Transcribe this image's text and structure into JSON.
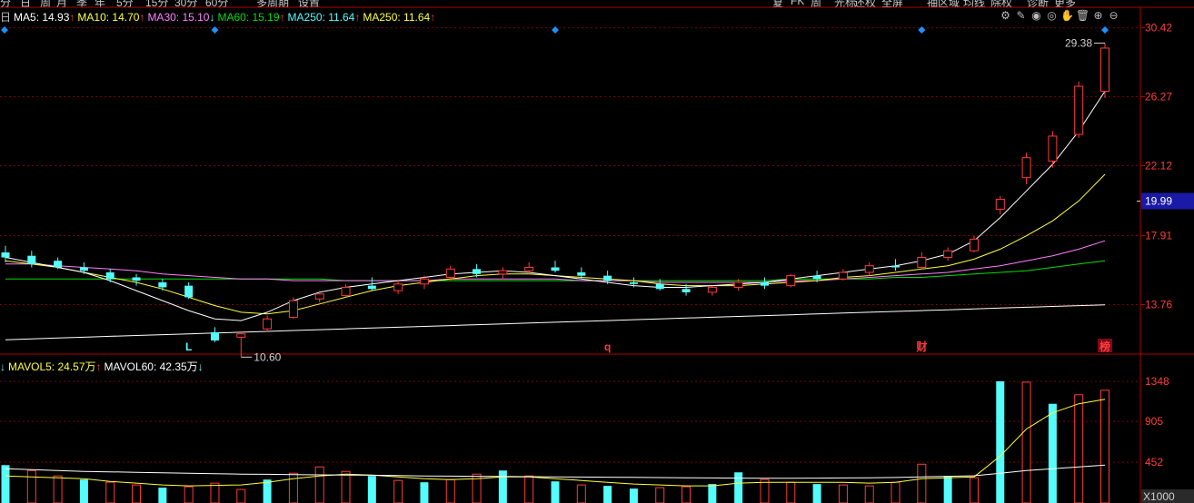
{
  "colors": {
    "up": "#ff3b3b",
    "down": "#54fcfc",
    "ma5": "#ffffff",
    "ma10": "#ffff3c",
    "ma30": "#ff80ff",
    "ma60": "#00e000",
    "ma250": "#ffffff",
    "grid": "#7a0000",
    "axis_text": "#ff3b3b",
    "diamond": "#1e90ff"
  },
  "toolbar": {
    "items": [
      "分",
      "日",
      "周",
      "月",
      "季",
      "年",
      "5分",
      "15分",
      "30分",
      "60分",
      "多周期",
      "设置",
      "复",
      "FK",
      "周",
      "光标",
      "还权",
      "全屏",
      "抽区域",
      "均线",
      "除权",
      "诊断",
      "更多"
    ]
  },
  "legend": {
    "prefix": "日",
    "items": [
      {
        "label": "MA5: 14.93",
        "arrow": "↑",
        "color": "#ffffff"
      },
      {
        "label": "MA10: 14.70",
        "arrow": "↑",
        "color": "#ffff3c"
      },
      {
        "label": "MA30: 15.10",
        "arrow": "↓",
        "color": "#ff80ff"
      },
      {
        "label": "MA60: 15.19",
        "arrow": "↑",
        "color": "#00e000"
      },
      {
        "label": "MA250: 11.64",
        "arrow": "↑",
        "color": "#54fcfc"
      },
      {
        "label": "MA250: 11.64",
        "arrow": "↑",
        "color": "#ffff3c"
      }
    ]
  },
  "vol_legend": {
    "items": [
      {
        "label": "↓",
        "arrow": "",
        "color": "#54fcfc"
      },
      {
        "label": "MAVOL5: 24.57万",
        "arrow": "↑",
        "color": "#ffff3c"
      },
      {
        "label": "MAVOL60: 42.35万",
        "arrow": "↓",
        "color": "#ffffff"
      }
    ]
  },
  "tools": {
    "icons": [
      "gear-icon",
      "pencil-icon",
      "eye-icon",
      "eye-closed-icon",
      "hand-icon",
      "trash-icon",
      "zoom-in-icon",
      "zoom-out-icon"
    ],
    "glyphs": [
      "⚙",
      "✎",
      "◉",
      "◎",
      "✋",
      "🗑",
      "⊕",
      "⊖"
    ]
  },
  "markers": {
    "high_label": "29.38",
    "low_label": "10.60",
    "current_price": "19.99",
    "letters": [
      {
        "text": "L",
        "color": "#54fcfc",
        "index": 7
      },
      {
        "text": "q",
        "color": "#ff3b3b",
        "index": 23
      },
      {
        "text": "财",
        "color": "#ff3b3b",
        "index": 35
      },
      {
        "text": "榜",
        "color": "#ff3b3b",
        "index": 42,
        "boxed": true
      }
    ],
    "diamond_indices": [
      0,
      8,
      21,
      35,
      42
    ]
  },
  "chart_data": [
    {
      "type": "candlestick",
      "title": "",
      "ylim": [
        11.0,
        31.0
      ],
      "yticks": [
        "30.42",
        "26.27",
        "22.12",
        "17.91",
        "13.76"
      ],
      "ytick_values": [
        30.42,
        26.27,
        22.12,
        17.91,
        13.76
      ],
      "candles": [
        {
          "o": 16.9,
          "h": 17.3,
          "l": 16.3,
          "c": 16.6
        },
        {
          "o": 16.7,
          "h": 17.0,
          "l": 16.0,
          "c": 16.2
        },
        {
          "o": 16.4,
          "h": 16.6,
          "l": 15.9,
          "c": 16.0
        },
        {
          "o": 16.0,
          "h": 16.3,
          "l": 15.6,
          "c": 15.8
        },
        {
          "o": 15.7,
          "h": 15.9,
          "l": 15.1,
          "c": 15.3
        },
        {
          "o": 15.4,
          "h": 15.6,
          "l": 14.9,
          "c": 15.2
        },
        {
          "o": 15.1,
          "h": 15.3,
          "l": 14.6,
          "c": 14.8
        },
        {
          "o": 14.9,
          "h": 15.1,
          "l": 14.1,
          "c": 14.2
        },
        {
          "o": 12.1,
          "h": 12.4,
          "l": 11.5,
          "c": 11.6
        },
        {
          "o": 11.8,
          "h": 12.1,
          "l": 10.6,
          "c": 12.0
        },
        {
          "o": 12.3,
          "h": 13.1,
          "l": 12.1,
          "c": 12.9
        },
        {
          "o": 13.0,
          "h": 14.2,
          "l": 12.9,
          "c": 14.0
        },
        {
          "o": 14.1,
          "h": 14.6,
          "l": 13.9,
          "c": 14.4
        },
        {
          "o": 14.3,
          "h": 15.0,
          "l": 14.2,
          "c": 14.8
        },
        {
          "o": 14.9,
          "h": 15.4,
          "l": 14.6,
          "c": 14.7
        },
        {
          "o": 14.6,
          "h": 15.2,
          "l": 14.4,
          "c": 15.0
        },
        {
          "o": 15.0,
          "h": 15.5,
          "l": 14.7,
          "c": 15.3
        },
        {
          "o": 15.4,
          "h": 16.1,
          "l": 15.2,
          "c": 15.9
        },
        {
          "o": 15.9,
          "h": 16.2,
          "l": 15.4,
          "c": 15.6
        },
        {
          "o": 15.6,
          "h": 16.0,
          "l": 15.3,
          "c": 15.8
        },
        {
          "o": 15.8,
          "h": 16.3,
          "l": 15.6,
          "c": 16.0
        },
        {
          "o": 16.0,
          "h": 16.4,
          "l": 15.7,
          "c": 15.8
        },
        {
          "o": 15.7,
          "h": 16.0,
          "l": 15.3,
          "c": 15.5
        },
        {
          "o": 15.5,
          "h": 15.8,
          "l": 15.0,
          "c": 15.2
        },
        {
          "o": 15.1,
          "h": 15.4,
          "l": 14.8,
          "c": 15.0
        },
        {
          "o": 15.0,
          "h": 15.3,
          "l": 14.6,
          "c": 14.7
        },
        {
          "o": 14.7,
          "h": 15.0,
          "l": 14.3,
          "c": 14.5
        },
        {
          "o": 14.5,
          "h": 14.9,
          "l": 14.3,
          "c": 14.8
        },
        {
          "o": 14.8,
          "h": 15.3,
          "l": 14.6,
          "c": 15.1
        },
        {
          "o": 15.1,
          "h": 15.4,
          "l": 14.7,
          "c": 14.9
        },
        {
          "o": 14.9,
          "h": 15.6,
          "l": 14.8,
          "c": 15.5
        },
        {
          "o": 15.5,
          "h": 15.8,
          "l": 15.1,
          "c": 15.3
        },
        {
          "o": 15.3,
          "h": 15.9,
          "l": 15.2,
          "c": 15.7
        },
        {
          "o": 15.7,
          "h": 16.3,
          "l": 15.5,
          "c": 16.1
        },
        {
          "o": 16.1,
          "h": 16.5,
          "l": 15.8,
          "c": 16.0
        },
        {
          "o": 16.0,
          "h": 16.9,
          "l": 15.9,
          "c": 16.6
        },
        {
          "o": 16.6,
          "h": 17.2,
          "l": 16.4,
          "c": 17.0
        },
        {
          "o": 17.0,
          "h": 17.9,
          "l": 16.9,
          "c": 17.7
        },
        {
          "o": 19.5,
          "h": 20.3,
          "l": 19.2,
          "c": 20.1
        },
        {
          "o": 21.4,
          "h": 22.9,
          "l": 21.0,
          "c": 22.6
        },
        {
          "o": 22.4,
          "h": 24.2,
          "l": 22.0,
          "c": 23.9
        },
        {
          "o": 24.0,
          "h": 27.2,
          "l": 23.8,
          "c": 26.9
        },
        {
          "o": 26.6,
          "h": 29.5,
          "l": 26.2,
          "c": 29.2
        }
      ],
      "ma_curves": {
        "ma5": [
          16.6,
          16.3,
          16.0,
          15.7,
          15.2,
          14.6,
          14.0,
          13.4,
          12.9,
          12.8,
          13.3,
          14.0,
          14.5,
          14.8,
          15.0,
          15.2,
          15.4,
          15.6,
          15.7,
          15.8,
          15.7,
          15.5,
          15.3,
          15.1,
          14.9,
          14.8,
          14.8,
          14.9,
          15.0,
          15.1,
          15.3,
          15.5,
          15.7,
          15.9,
          16.1,
          16.4,
          16.8,
          17.6,
          19.0,
          20.6,
          22.2,
          24.2,
          26.6
        ],
        "ma10": [
          16.4,
          16.2,
          16.0,
          15.7,
          15.4,
          15.1,
          14.7,
          14.2,
          13.7,
          13.3,
          13.2,
          13.4,
          13.8,
          14.2,
          14.6,
          14.9,
          15.1,
          15.3,
          15.5,
          15.6,
          15.6,
          15.5,
          15.4,
          15.3,
          15.2,
          15.0,
          14.9,
          14.9,
          14.9,
          15.0,
          15.1,
          15.2,
          15.4,
          15.5,
          15.7,
          15.9,
          16.1,
          16.5,
          17.1,
          17.9,
          18.8,
          20.0,
          21.6
        ],
        "ma30": [
          16.2,
          16.2,
          16.1,
          16.0,
          15.9,
          15.8,
          15.6,
          15.5,
          15.4,
          15.3,
          15.3,
          15.2,
          15.2,
          15.2,
          15.2,
          15.2,
          15.2,
          15.3,
          15.3,
          15.3,
          15.3,
          15.3,
          15.2,
          15.2,
          15.2,
          15.1,
          15.1,
          15.1,
          15.1,
          15.1,
          15.2,
          15.2,
          15.3,
          15.4,
          15.5,
          15.6,
          15.7,
          15.9,
          16.1,
          16.4,
          16.7,
          17.1,
          17.6
        ],
        "ma60": [
          15.3,
          15.3,
          15.3,
          15.3,
          15.3,
          15.3,
          15.3,
          15.3,
          15.3,
          15.3,
          15.3,
          15.3,
          15.3,
          15.2,
          15.2,
          15.2,
          15.2,
          15.2,
          15.2,
          15.2,
          15.2,
          15.2,
          15.2,
          15.2,
          15.2,
          15.2,
          15.2,
          15.2,
          15.2,
          15.2,
          15.3,
          15.3,
          15.3,
          15.3,
          15.4,
          15.4,
          15.5,
          15.6,
          15.7,
          15.8,
          16.0,
          16.2,
          16.4
        ],
        "ma250": [
          11.64,
          11.7,
          11.75,
          11.8,
          11.85,
          11.9,
          11.95,
          12.0,
          12.05,
          12.1,
          12.15,
          12.2,
          12.25,
          12.3,
          12.35,
          12.4,
          12.45,
          12.5,
          12.55,
          12.6,
          12.65,
          12.7,
          12.75,
          12.8,
          12.85,
          12.9,
          12.95,
          13.0,
          13.05,
          13.1,
          13.15,
          13.2,
          13.25,
          13.3,
          13.35,
          13.4,
          13.45,
          13.5,
          13.55,
          13.6,
          13.65,
          13.7,
          13.75
        ]
      }
    },
    {
      "type": "bar",
      "title": "",
      "ylabel": "X1000",
      "ylim": [
        0,
        1500
      ],
      "yticks": [
        "1348",
        "905",
        "452"
      ],
      "ytick_values": [
        1348,
        905,
        452
      ],
      "values": [
        420,
        360,
        300,
        260,
        230,
        200,
        170,
        180,
        220,
        150,
        260,
        330,
        400,
        350,
        300,
        250,
        230,
        260,
        320,
        360,
        300,
        240,
        200,
        190,
        160,
        170,
        180,
        210,
        340,
        260,
        230,
        210,
        200,
        190,
        230,
        430,
        300,
        280,
        1350,
        1340,
        1100,
        1200,
        1250
      ],
      "up": [
        false,
        true,
        true,
        false,
        true,
        true,
        false,
        true,
        true,
        true,
        false,
        true,
        true,
        true,
        false,
        true,
        false,
        true,
        true,
        false,
        true,
        false,
        true,
        false,
        false,
        true,
        true,
        false,
        false,
        true,
        true,
        false,
        true,
        true,
        true,
        true,
        false,
        true,
        false,
        true,
        false,
        true,
        true
      ],
      "mavol5": [
        300,
        290,
        280,
        270,
        240,
        220,
        200,
        190,
        195,
        200,
        230,
        270,
        300,
        320,
        310,
        290,
        270,
        260,
        270,
        290,
        290,
        270,
        250,
        230,
        210,
        200,
        190,
        190,
        220,
        230,
        230,
        230,
        230,
        220,
        230,
        270,
        280,
        290,
        520,
        820,
        1000,
        1100,
        1150
      ],
      "mavol60": [
        380,
        370,
        360,
        350,
        345,
        340,
        335,
        330,
        325,
        320,
        318,
        315,
        312,
        310,
        308,
        305,
        300,
        298,
        296,
        294,
        292,
        290,
        288,
        286,
        284,
        282,
        280,
        278,
        276,
        275,
        275,
        276,
        278,
        280,
        283,
        290,
        296,
        302,
        330,
        360,
        380,
        400,
        420
      ]
    }
  ]
}
